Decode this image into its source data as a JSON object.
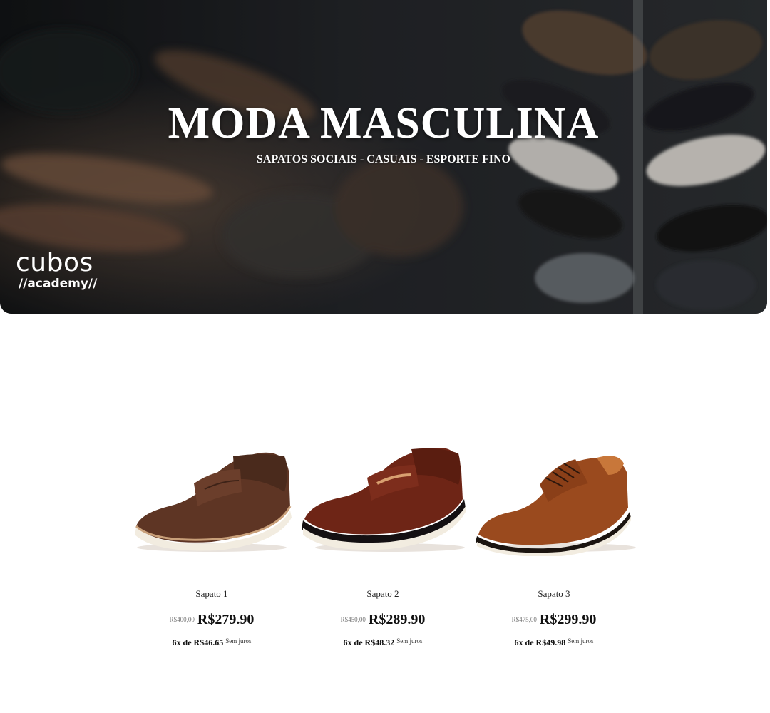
{
  "hero": {
    "title": "MODA MASCULINA",
    "subtitle": "SAPATOS SOCIAIS - CASUAIS - ESPORTE FINO",
    "background": "dark-mens-shoes-photo",
    "logo": {
      "word": "cubos",
      "sub": "//academy//"
    }
  },
  "products": [
    {
      "name": "Sapato 1",
      "old_price": "R$400,00",
      "price": "R$279.90",
      "installments": "6x de R$46.65",
      "no_interest": "Sem juros",
      "image": "brown-suede-loafer",
      "color": "#5a3222"
    },
    {
      "name": "Sapato 2",
      "old_price": "R$450,00",
      "price": "R$289.90",
      "installments": "6x de R$48.32",
      "no_interest": "Sem juros",
      "image": "brown-leather-loafer",
      "color": "#6e2516"
    },
    {
      "name": "Sapato 3",
      "old_price": "R$475,00",
      "price": "R$299.90",
      "installments": "6x de R$49.98",
      "no_interest": "Sem juros",
      "image": "tan-leather-derby",
      "color": "#9a4a1e"
    }
  ]
}
